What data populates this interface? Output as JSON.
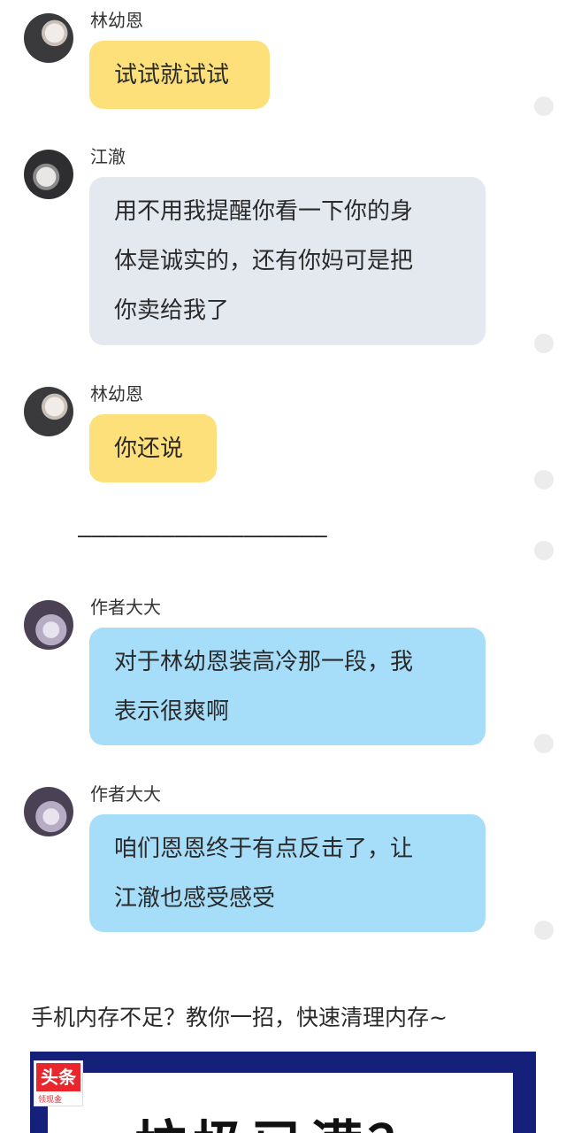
{
  "messages": [
    {
      "sender": "林幼恩",
      "avatar": "girl-avatar",
      "bubble_color": "#fde07a",
      "lines": [
        "试试就试试"
      ]
    },
    {
      "sender": "江澈",
      "avatar": "boy-avatar",
      "bubble_color": "#e4e8ef",
      "lines": [
        "用不用我提醒你看一下你的身",
        "体是诚实的，还有你妈可是把",
        "你卖给我了"
      ]
    },
    {
      "sender": "林幼恩",
      "avatar": "girl-avatar",
      "bubble_color": "#fde07a",
      "lines": [
        "你还说"
      ]
    },
    {
      "sender": "作者大大",
      "avatar": "author-avatar",
      "bubble_color": "#a6defa",
      "lines": [
        "对于林幼恩装高冷那一段，我",
        "表示很爽啊"
      ]
    },
    {
      "sender": "作者大大",
      "avatar": "author-avatar",
      "bubble_color": "#a6defa",
      "lines": [
        "咱们恩恩终于有点反击了，让",
        "江澈也感受感受"
      ]
    }
  ],
  "divider": "——————————————————",
  "ad": {
    "text": "手机内存不足？教你一招，快速清理内存~",
    "logo_text": "头条",
    "logo_subtext": "领现金",
    "headline": "垃圾已满？"
  }
}
